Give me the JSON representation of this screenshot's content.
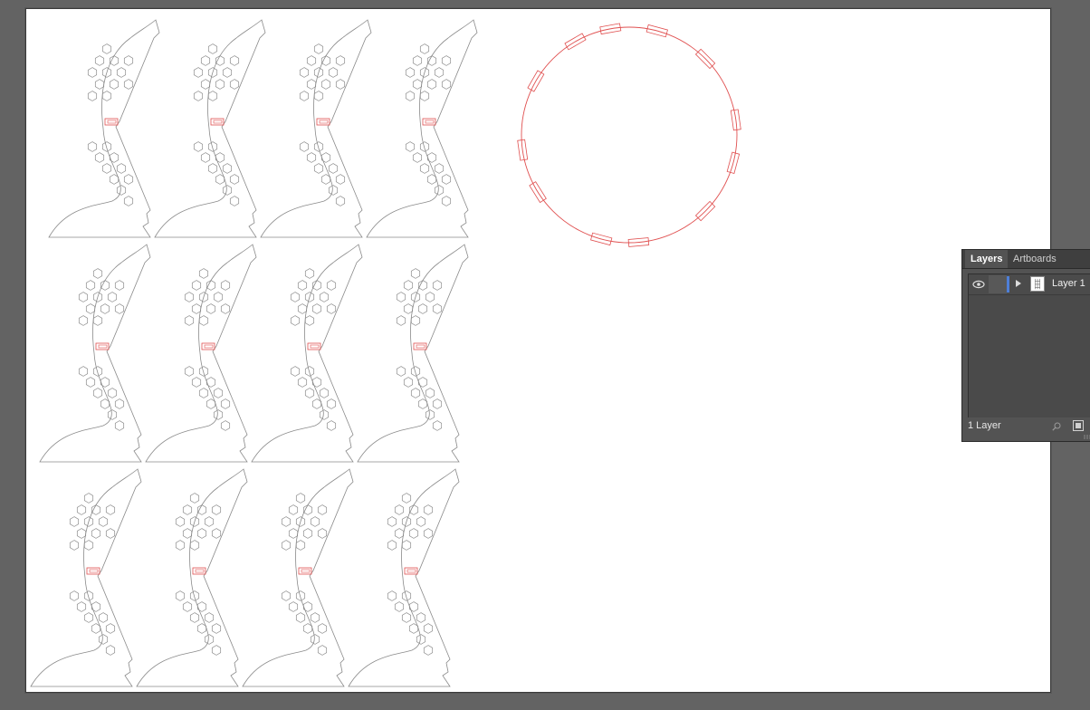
{
  "panel": {
    "tabs": [
      {
        "label": "Layers",
        "active": true
      },
      {
        "label": "Artboards",
        "active": false
      }
    ],
    "layers": [
      {
        "name": "Layer 1",
        "visible": true,
        "color": "#4e7fd8"
      }
    ],
    "footer_status": "1 Layer",
    "icons": {
      "visibility": "eye-icon",
      "expand": "disclosure-triangle-icon",
      "search": "search-icon",
      "new_layer": "new-layer-icon"
    }
  },
  "colors": {
    "workspace_bg": "#636363",
    "artboard": "#ffffff",
    "cut_line": "#8a8a8a",
    "score_line": "#e05050",
    "selection_accent": "#4e7fd8"
  }
}
